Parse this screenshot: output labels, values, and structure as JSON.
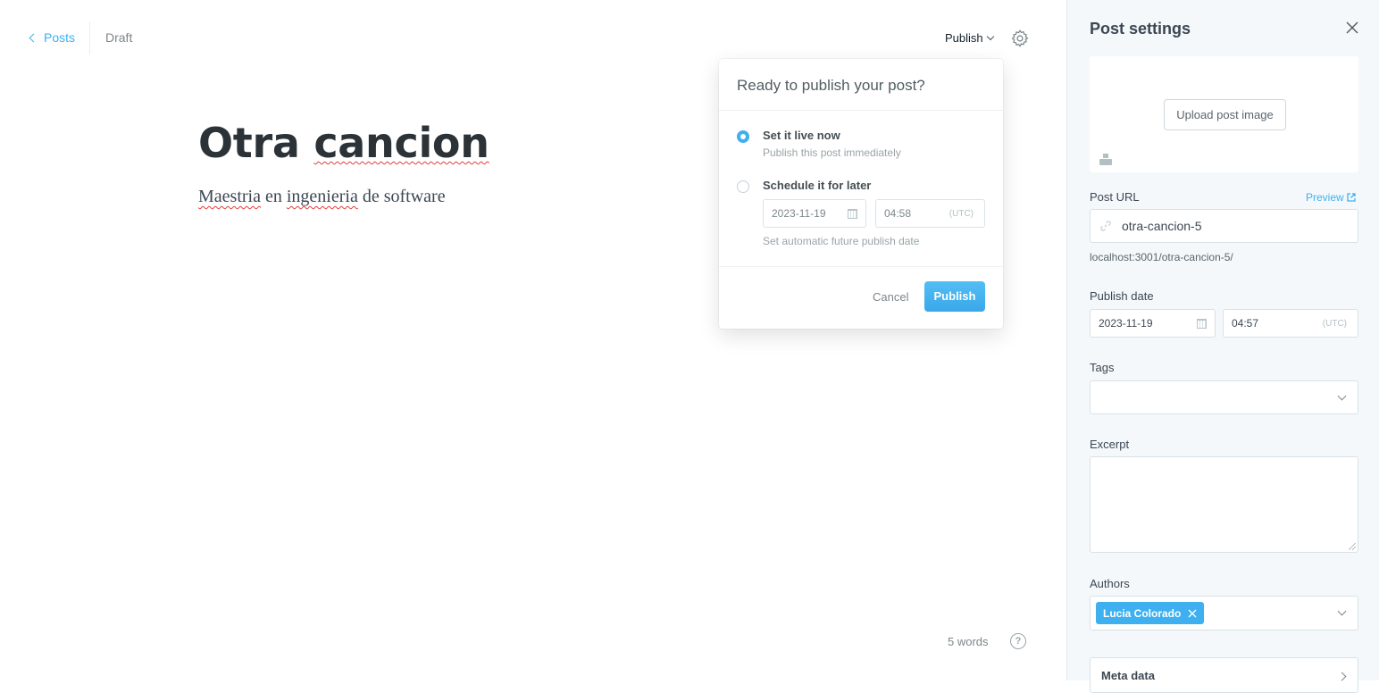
{
  "header": {
    "back_label": "Posts",
    "status": "Draft",
    "publish_menu_label": "Publish"
  },
  "post": {
    "title_prefix": "Otra ",
    "title_misspelled": "cancion",
    "body": [
      "Maestria",
      " en ",
      "ingenieria",
      " de software"
    ]
  },
  "publish_popover": {
    "title": "Ready to publish your post?",
    "option_now_label": "Set it live now",
    "option_now_desc": "Publish this post immediately",
    "option_later_label": "Schedule it for later",
    "schedule_date": "2023-11-19",
    "schedule_time": "04:58",
    "timezone": "(UTC)",
    "schedule_hint": "Set automatic future publish date",
    "selected_option": "now",
    "cancel_label": "Cancel",
    "publish_label": "Publish"
  },
  "footer": {
    "word_count": "5 words",
    "help_glyph": "?"
  },
  "sidebar": {
    "title": "Post settings",
    "upload_label": "Upload post image",
    "post_url_label": "Post URL",
    "preview_label": "Preview",
    "slug": "otra-cancion-5",
    "full_url": "localhost:3001/otra-cancion-5/",
    "publish_date_label": "Publish date",
    "publish_date": "2023-11-19",
    "publish_time": "04:57",
    "timezone": "(UTC)",
    "tags_label": "Tags",
    "excerpt_label": "Excerpt",
    "authors_label": "Authors",
    "author": "Lucia Colorado",
    "meta_label": "Meta data"
  },
  "colors": {
    "accent": "#3eb0ef",
    "spell_error": "#e23d3d",
    "sidebar_bg": "#f4f8fb"
  }
}
